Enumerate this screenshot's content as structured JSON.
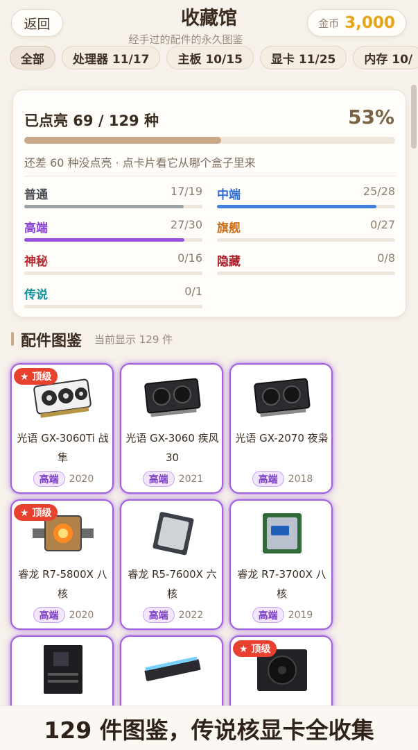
{
  "header": {
    "back_label": "返回",
    "title": "收藏馆",
    "subtitle": "经手过的配件的永久图鉴",
    "coin_label": "金币",
    "coin_value": "3,000"
  },
  "tabs": [
    {
      "label": "全部",
      "active": true
    },
    {
      "label": "处理器 11/17",
      "active": false
    },
    {
      "label": "主板 10/15",
      "active": false
    },
    {
      "label": "显卡 11/25",
      "active": false
    },
    {
      "label": "内存 10/",
      "active": false
    }
  ],
  "summary": {
    "title": "已点亮 69 / 129 种",
    "percent_label": "53%",
    "percent": 0.53,
    "hint": "还差 60 种没点亮 · 点卡片看它从哪个盒子里来"
  },
  "rarities": [
    {
      "name": "普通",
      "count": "17/19",
      "fraction": 0.895,
      "color": "#9aa0a6",
      "name_color": "#4a4f55"
    },
    {
      "name": "中端",
      "count": "25/28",
      "fraction": 0.893,
      "color": "#3f7fe0",
      "name_color": "#2f6fd6"
    },
    {
      "name": "高端",
      "count": "27/30",
      "fraction": 0.9,
      "color": "#9a4fe3",
      "name_color": "#8a3fd6"
    },
    {
      "name": "旗舰",
      "count": "0/27",
      "fraction": 0,
      "color": "#d4781f",
      "name_color": "#c9701c"
    },
    {
      "name": "神秘",
      "count": "0/16",
      "fraction": 0,
      "color": "#c2313a",
      "name_color": "#b82b33"
    },
    {
      "name": "隐藏",
      "count": "0/8",
      "fraction": 0,
      "color": "#b5212a",
      "name_color": "#a91f28"
    },
    {
      "name": "传说",
      "count": "0/1",
      "fraction": 0,
      "color": "#1c9aa8",
      "name_color": "#14909e"
    }
  ],
  "section": {
    "title": "配件图鉴",
    "subtitle": "当前显示 129 件"
  },
  "badge_label": "★ 顶级",
  "items": [
    {
      "name": "光语 GX-3060Ti 战隼",
      "tier": "高端",
      "year": "2020",
      "top": true,
      "kind": "gpu-white"
    },
    {
      "name": "光语 GX-3060 疾风30",
      "tier": "高端",
      "year": "2021",
      "top": false,
      "kind": "gpu-dark"
    },
    {
      "name": "光语 GX-2070 夜枭",
      "tier": "高端",
      "year": "2018",
      "top": false,
      "kind": "gpu-dark"
    },
    {
      "name": "睿龙 R7-5800X 八核",
      "tier": "高端",
      "year": "2020",
      "top": true,
      "kind": "cpu-fire"
    },
    {
      "name": "睿龙 R5-7600X 六核",
      "tier": "高端",
      "year": "2022",
      "top": false,
      "kind": "cpu-silver"
    },
    {
      "name": "睿龙 R7-3700X 八核",
      "tier": "高端",
      "year": "2019",
      "top": false,
      "kind": "cpu-blue"
    },
    {
      "name": "",
      "tier": "",
      "year": "",
      "top": false,
      "kind": "mobo"
    },
    {
      "name": "",
      "tier": "",
      "year": "",
      "top": false,
      "kind": "ram"
    },
    {
      "name": "",
      "tier": "",
      "year": "",
      "top": true,
      "kind": "psu"
    }
  ],
  "caption": "129 件图鉴，传说核显卡全收集"
}
